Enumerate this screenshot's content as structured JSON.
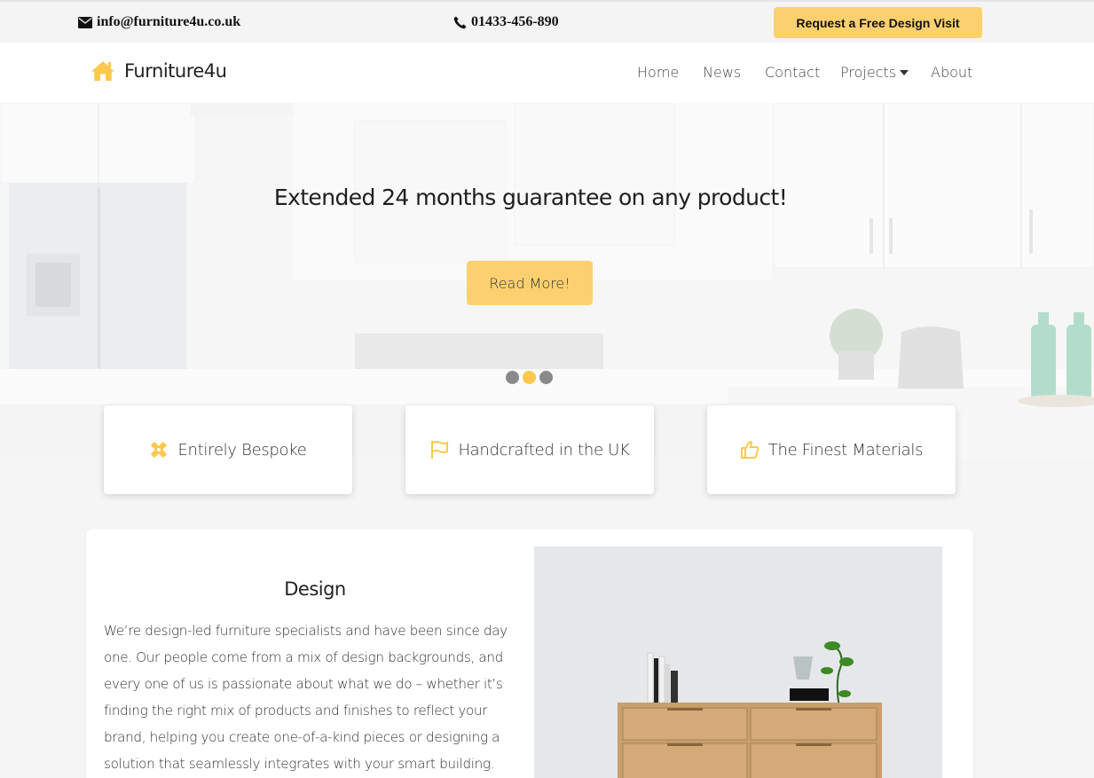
{
  "topbar": {
    "email": "info@furniture4u.co.uk",
    "phone": "01433-456-890",
    "cta_label": "Request a Free Design Visit"
  },
  "nav": {
    "brand": "Furniture4u",
    "links": {
      "home": "Home",
      "news": "News",
      "contact": "Contact",
      "projects": "Projects",
      "about": "About"
    }
  },
  "hero": {
    "title": "Extended 24 months guarantee on any product!",
    "button_label": "Read More!",
    "slides_count": 3,
    "active_slide": 2
  },
  "features": [
    {
      "label": "Entirely Bespoke",
      "icon": "pencil-ruler-icon"
    },
    {
      "label": "Handcrafted in the UK",
      "icon": "flag-icon"
    },
    {
      "label": "The Finest Materials",
      "icon": "thumbs-up-icon"
    }
  ],
  "design": {
    "title": "Design",
    "text": "We’re design-led furniture specialists and have been since day one. Our people come from a mix of design backgrounds, and every one of us is passionate about what we do – whether it’s finding the right mix of products and finishes to reflect your brand, helping you create one-of-a-kind pieces or designing a solution that seamlessly integrates with your smart building. Every"
  },
  "colors": {
    "accent": "#fdd06f",
    "icon_accent": "#fcc94e",
    "page_bg": "#f5f5f5"
  }
}
